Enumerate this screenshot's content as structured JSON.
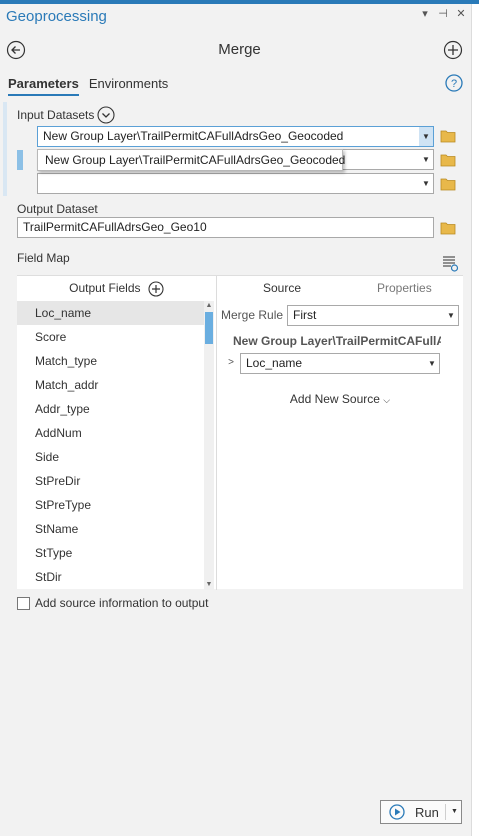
{
  "pane": {
    "title": "Geoprocessing",
    "controls": [
      "▾",
      "⊣",
      "✕"
    ]
  },
  "tool": {
    "title": "Merge"
  },
  "tabs": {
    "parameters": "Parameters",
    "environments": "Environments"
  },
  "help_glyph": "?",
  "input_datasets": {
    "label": "Input Datasets",
    "rows": [
      "New Group Layer\\TrailPermitCAFullAdrsGeo_Geocoded",
      "",
      ""
    ],
    "dropdown_suggestion": "New Group Layer\\TrailPermitCAFullAdrsGeo_Geocoded"
  },
  "output_dataset": {
    "label": "Output Dataset",
    "value": "TrailPermitCAFullAdrsGeo_Geo10"
  },
  "field_map": {
    "label": "Field Map",
    "output_fields_header": "Output Fields",
    "fields": [
      "Loc_name",
      "Score",
      "Match_type",
      "Match_addr",
      "Addr_type",
      "AddNum",
      "Side",
      "StPreDir",
      "StPreType",
      "StName",
      "StType",
      "StDir"
    ],
    "selected_field": "Loc_name",
    "tabs": {
      "source": "Source",
      "properties": "Properties"
    },
    "merge_rule_label": "Merge Rule",
    "merge_rule_value": "First",
    "source_layer": "New Group Layer\\TrailPermitCAFullAdrsGeo_Geocoded",
    "source_field": "Loc_name",
    "add_new_source": "Add New Source"
  },
  "add_source_info": {
    "label": "Add source information to output",
    "checked": false
  },
  "run": {
    "label": "Run"
  },
  "colors": {
    "accent": "#2a7ab8",
    "scroll_thumb": "#6aaee0",
    "folder": "#e8b84a"
  }
}
